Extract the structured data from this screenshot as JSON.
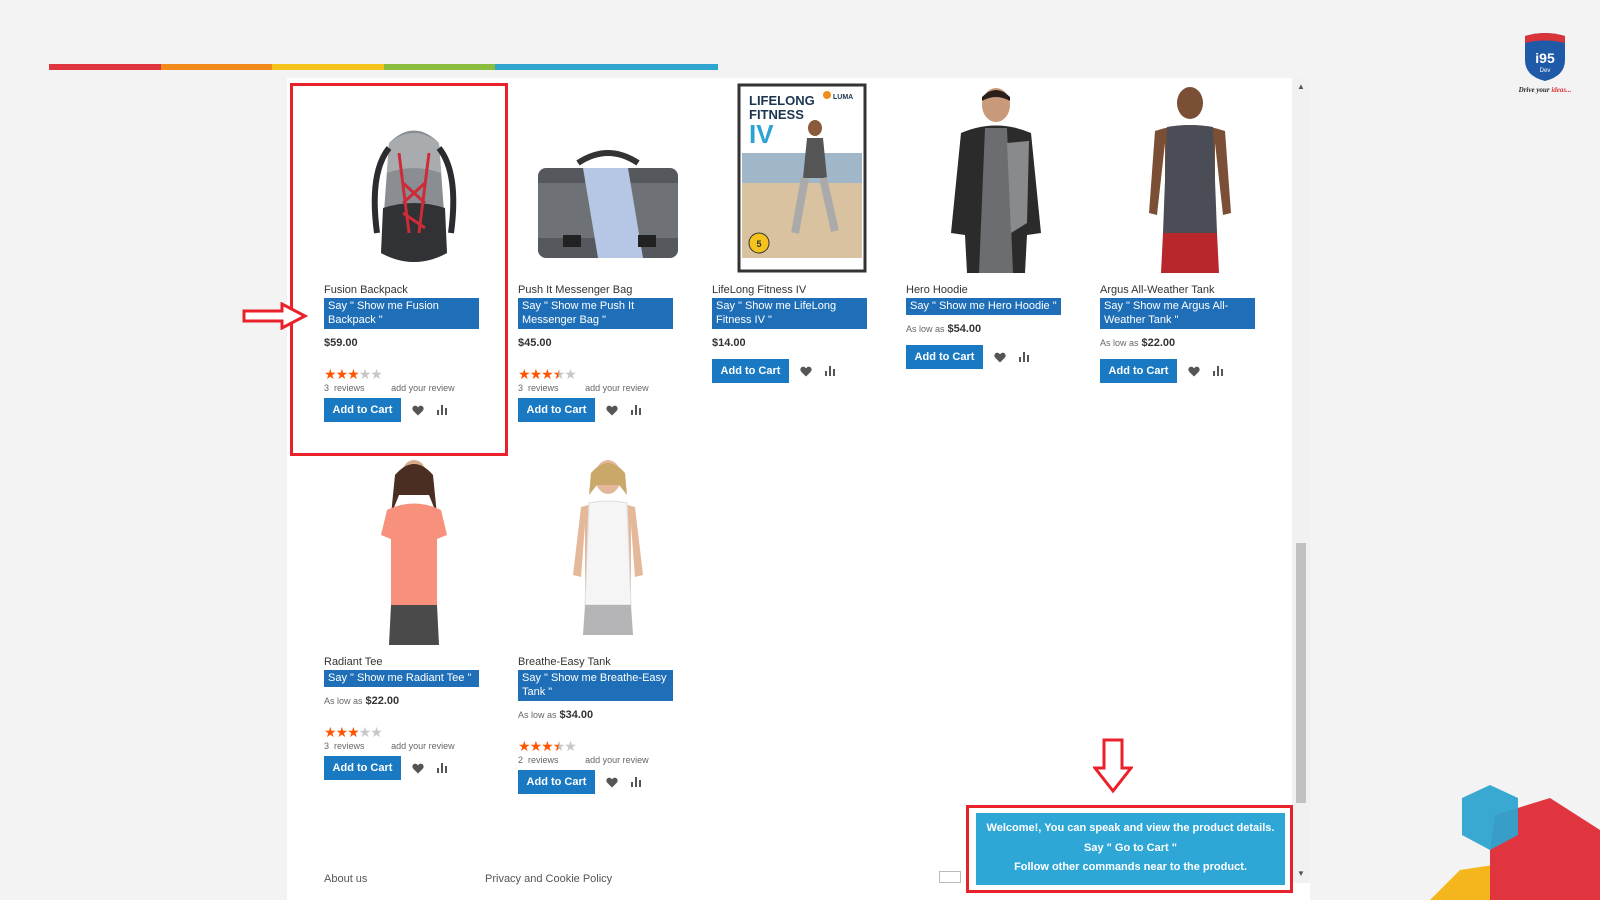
{
  "colors": {
    "accent_bar": [
      "#e0353f",
      "#f18c1c",
      "#f5c31c",
      "#8bbe3f",
      "#2fa4cf",
      "#2fa4cf"
    ],
    "button_blue": "#1979c3",
    "say_blue": "#1f6fb8",
    "notice_blue": "#2fa7d6",
    "highlight_red": "#e8212b",
    "star_orange": "#ff5501"
  },
  "logo": {
    "text": "i95",
    "subtext": "Dev",
    "tagline_start": "Drive your ",
    "tagline_accent": "ideas..."
  },
  "products": [
    {
      "name": "Fusion Backpack",
      "say": "Say \" Show me Fusion Backpack \"",
      "price_label": "",
      "price": "$59.00",
      "rating": 3,
      "rating_max": 5,
      "reviews_count": "3",
      "reviews_label": "reviews",
      "add_review": "add your review",
      "cart_label": "Add to Cart",
      "image_icon": "backpack-image"
    },
    {
      "name": "Push It Messenger Bag",
      "say": "Say \" Show me Push It Messenger Bag \"",
      "price_label": "",
      "price": "$45.00",
      "rating": 3.5,
      "rating_max": 5,
      "reviews_count": "3",
      "reviews_label": "reviews",
      "add_review": "add your review",
      "cart_label": "Add to Cart",
      "image_icon": "messenger-bag-image"
    },
    {
      "name": "LifeLong Fitness IV",
      "say": "Say \" Show me LifeLong Fitness IV \"",
      "price_label": "",
      "price": "$14.00",
      "cart_label": "Add to Cart",
      "image_icon": "dvd-cover-image",
      "dvd_title_1": "LIFELONG",
      "dvd_title_2": "FITNESS",
      "dvd_title_3": "IV",
      "dvd_brand": "LUMA"
    },
    {
      "name": "Hero Hoodie",
      "say": "Say \" Show me Hero Hoodie \"",
      "price_label": "As low as",
      "price": "$54.00",
      "cart_label": "Add to Cart",
      "image_icon": "hoodie-model-image"
    },
    {
      "name": "Argus All-Weather Tank",
      "say": "Say \" Show me Argus All-Weather Tank \"",
      "price_label": "As low as",
      "price": "$22.00",
      "cart_label": "Add to Cart",
      "image_icon": "tank-model-image"
    },
    {
      "name": "Radiant Tee",
      "say": "Say \" Show me Radiant Tee \"",
      "price_label": "As low as",
      "price": "$22.00",
      "rating": 3,
      "rating_max": 5,
      "reviews_count": "3",
      "reviews_label": "reviews",
      "add_review": "add your review",
      "cart_label": "Add to Cart",
      "image_icon": "tee-model-image"
    },
    {
      "name": "Breathe-Easy Tank",
      "say": "Say \" Show me Breathe-Easy Tank \"",
      "price_label": "As low as",
      "price": "$34.00",
      "rating": 3.5,
      "rating_max": 5,
      "reviews_count": "2",
      "reviews_label": "reviews",
      "add_review": "add your review",
      "cart_label": "Add to Cart",
      "image_icon": "women-tank-model-image"
    }
  ],
  "notice": {
    "line1": "Welcome!, You can speak and view the product details.",
    "line2": "Say \" Go to Cart \"",
    "line3": "Follow other commands near to the product."
  },
  "footer": {
    "about": "About us",
    "privacy": "Privacy and Cookie Policy"
  }
}
